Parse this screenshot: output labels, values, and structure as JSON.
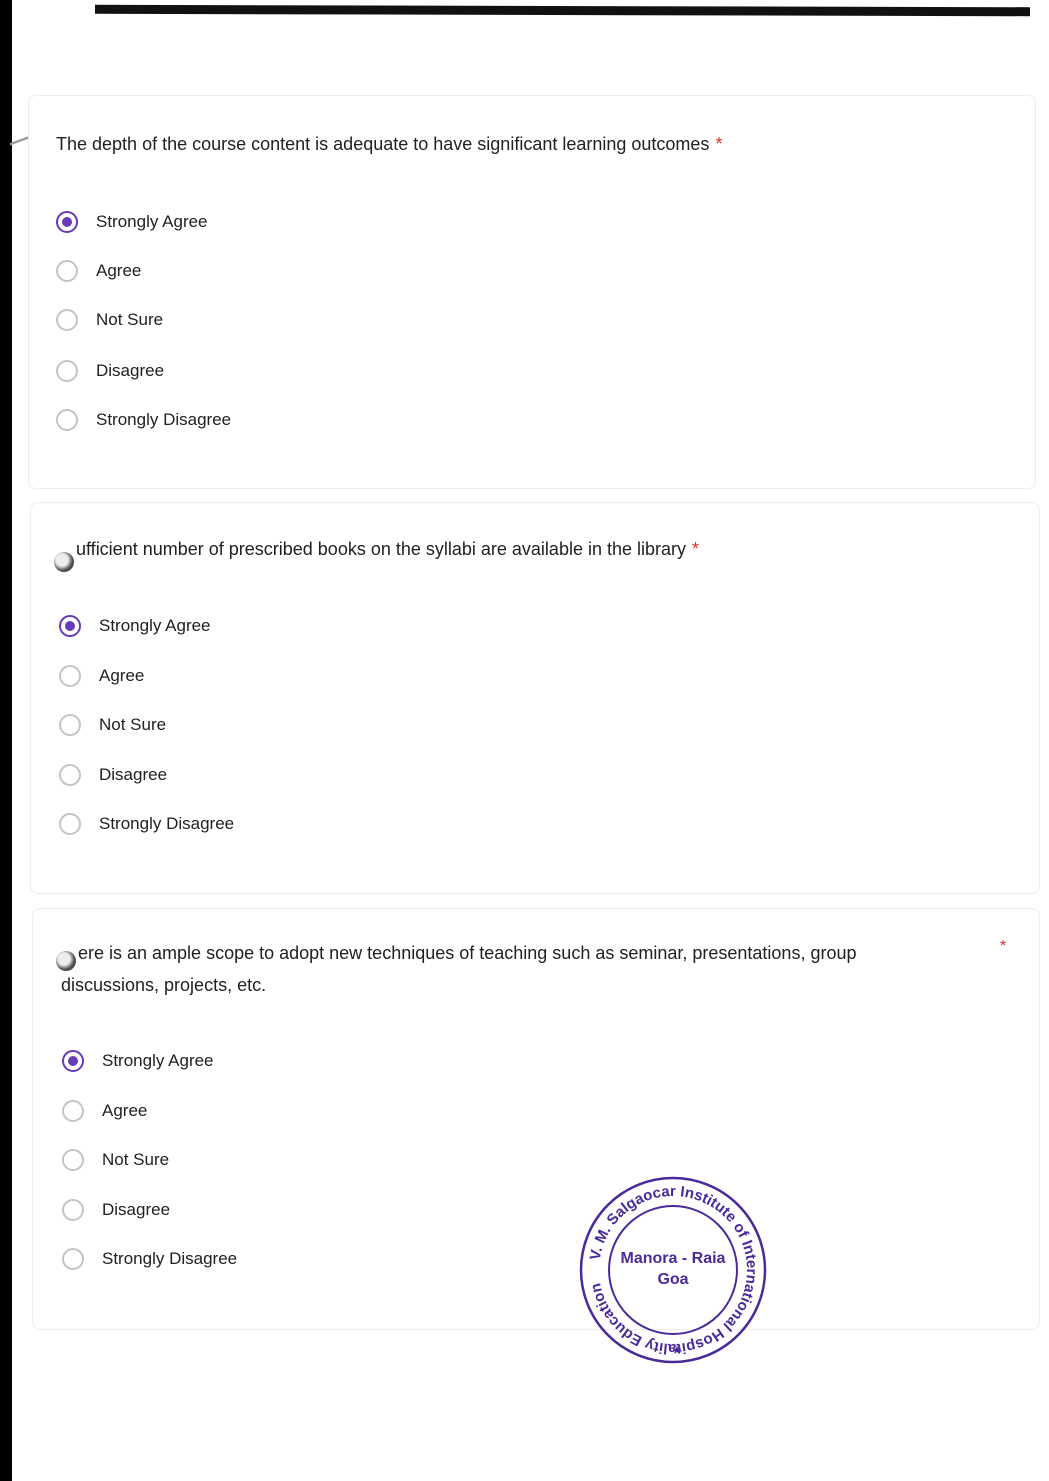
{
  "questions": [
    {
      "text": "The depth of the course content is adequate to have significant learning outcomes",
      "required_mark": "*",
      "options": [
        "Strongly Agree",
        "Agree",
        "Not Sure",
        "Disagree",
        "Strongly Disagree"
      ],
      "selected": "Strongly Agree"
    },
    {
      "text": "ufficient number of prescribed books on the syllabi are available in the library",
      "required_mark": "*",
      "options": [
        "Strongly Agree",
        "Agree",
        "Not Sure",
        "Disagree",
        "Strongly Disagree"
      ],
      "selected": "Strongly Agree"
    },
    {
      "text_line1": "ere is an ample scope to adopt new techniques of teaching such as seminar, presentations, group",
      "text_line2": "discussions, projects, etc.",
      "required_mark": "*",
      "options": [
        "Strongly Agree",
        "Agree",
        "Not Sure",
        "Disagree",
        "Strongly Disagree"
      ],
      "selected": "Strongly Agree"
    }
  ],
  "stamp": {
    "ring_text": "V. M. Salgaocar Institute of International Hospitality Education",
    "center_line1": "Manora - Raia",
    "center_line2": "Goa",
    "color": "#4a2a9a"
  },
  "colors": {
    "accent": "#673ab7",
    "required": "#d93025"
  }
}
